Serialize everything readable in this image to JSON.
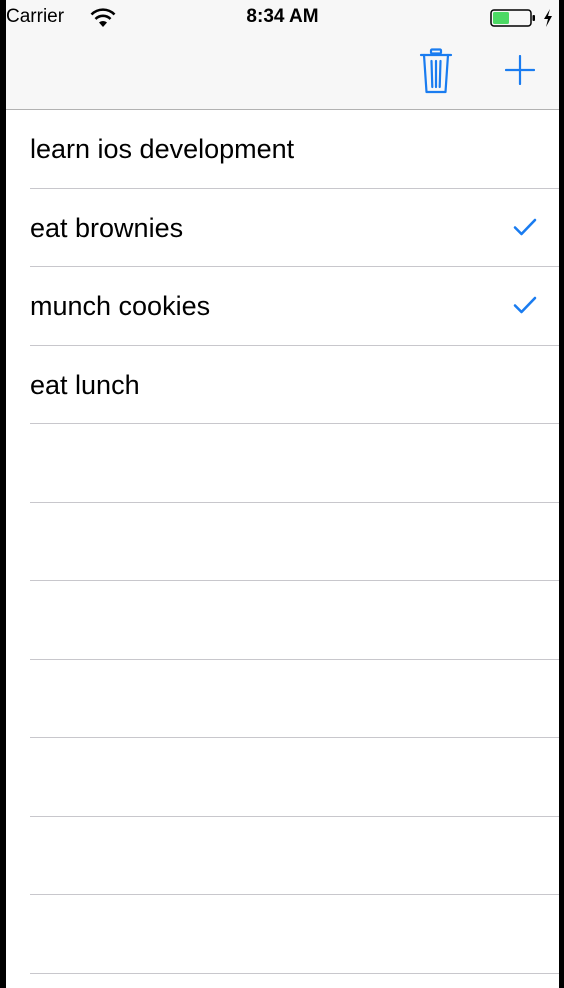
{
  "status_bar": {
    "carrier": "Carrier",
    "time": "8:34 AM",
    "icons": [
      "wifi-icon",
      "battery-icon",
      "charging-icon"
    ]
  },
  "nav_bar": {
    "buttons": [
      {
        "name": "trash-button",
        "icon": "trash-icon"
      },
      {
        "name": "add-button",
        "icon": "plus-icon"
      }
    ]
  },
  "todo_items": [
    {
      "title": "learn ios development",
      "checked": false
    },
    {
      "title": "eat brownies",
      "checked": true
    },
    {
      "title": "munch cookies",
      "checked": true
    },
    {
      "title": "eat lunch",
      "checked": false
    },
    {
      "title": "",
      "checked": false
    },
    {
      "title": "",
      "checked": false
    },
    {
      "title": "",
      "checked": false
    },
    {
      "title": "",
      "checked": false
    },
    {
      "title": "",
      "checked": false
    },
    {
      "title": "",
      "checked": false
    },
    {
      "title": "",
      "checked": false
    }
  ],
  "colors": {
    "accent": "#1a7cf0",
    "nav_background": "#f7f7f7",
    "separator": "#c8c7cc"
  }
}
